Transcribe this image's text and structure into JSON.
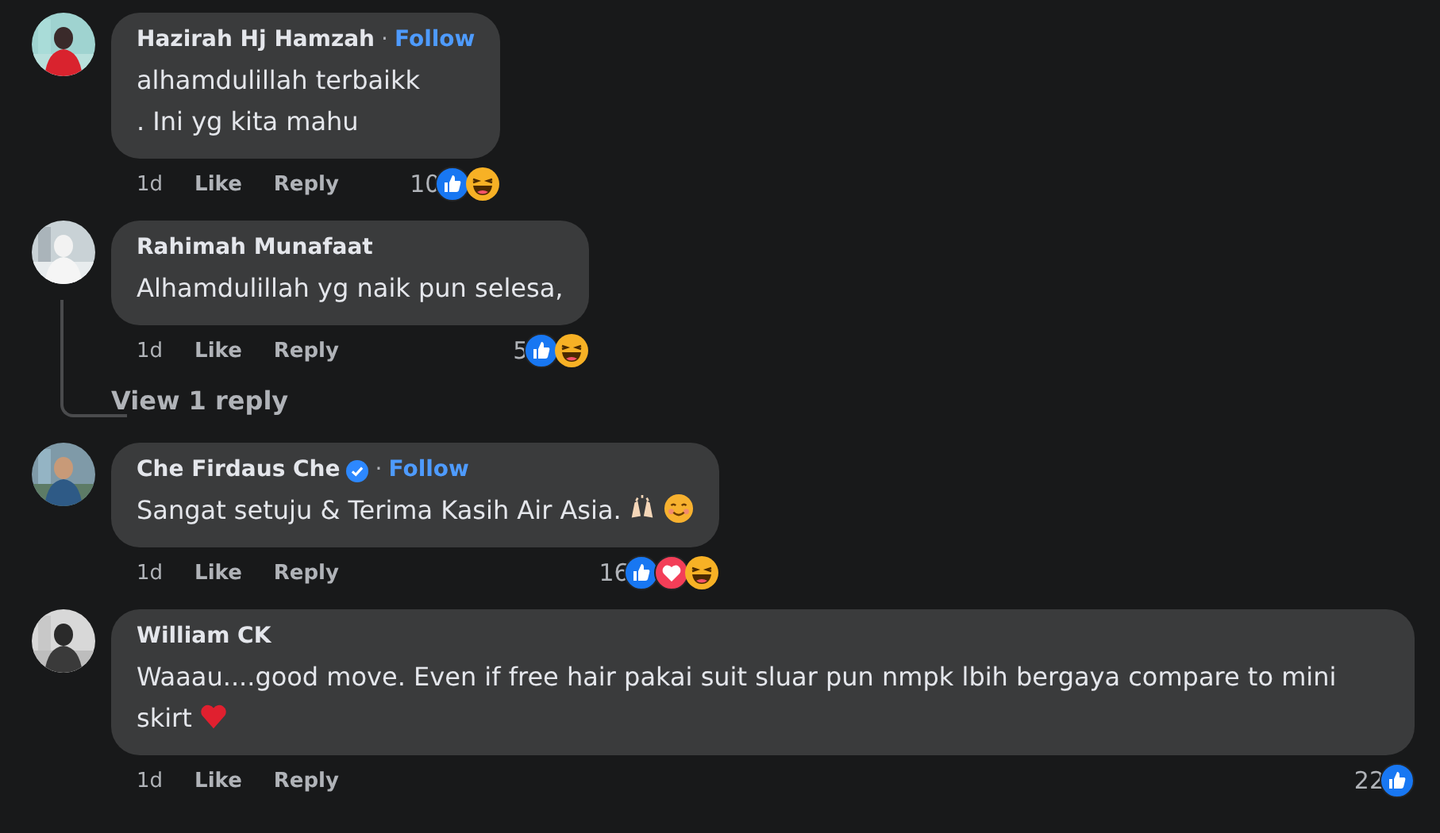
{
  "comments": [
    {
      "author": "Hazirah Hj Hamzah",
      "verified": false,
      "separator": "·",
      "follow": "Follow",
      "lines": [
        "alhamdulillah terbaikk",
        ". Ini yg kita mahu"
      ],
      "time": "1d",
      "like": "Like",
      "reply": "Reply",
      "reaction_count": "10",
      "reactions": [
        {
          "kind": "like"
        },
        {
          "kind": "haha"
        }
      ]
    },
    {
      "author": "Rahimah Munafaat",
      "verified": false,
      "lines": [
        "Alhamdulillah yg naik pun selesa,"
      ],
      "time": "1d",
      "like": "Like",
      "reply": "Reply",
      "reaction_count": "5",
      "reactions": [
        {
          "kind": "like"
        },
        {
          "kind": "haha"
        }
      ],
      "replies_link": "View 1 reply"
    },
    {
      "author": "Che Firdaus Che",
      "verified": true,
      "separator": "·",
      "follow": "Follow",
      "lines": [
        "Sangat setuju & Terima Kasih Air Asia."
      ],
      "inline_icons": [
        {
          "kind": "hands"
        },
        {
          "kind": "smile"
        }
      ],
      "time": "1d",
      "like": "Like",
      "reply": "Reply",
      "reaction_count": "16",
      "reactions": [
        {
          "kind": "like"
        },
        {
          "kind": "love"
        },
        {
          "kind": "haha"
        }
      ]
    },
    {
      "author": "William CK",
      "verified": false,
      "lines": [
        "Waaau....good move. Even if free hair pakai suit sluar pun nmpk lbih bergaya compare to mini skirt"
      ],
      "inline_icons": [
        {
          "kind": "heart"
        }
      ],
      "time": "1d",
      "like": "Like",
      "reply": "Reply",
      "reaction_count": "22",
      "reactions": [
        {
          "kind": "like"
        }
      ]
    }
  ]
}
